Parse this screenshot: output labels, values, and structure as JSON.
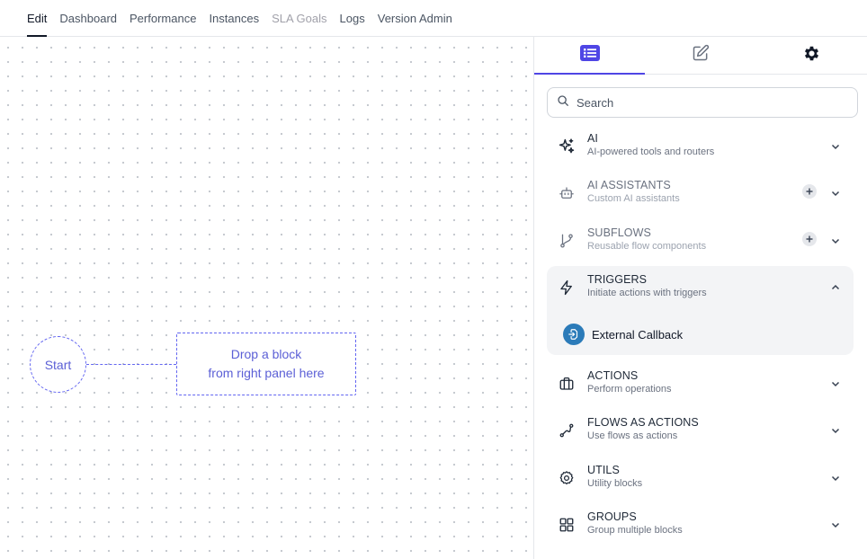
{
  "nav": {
    "tabs": [
      {
        "label": "Edit"
      },
      {
        "label": "Dashboard"
      },
      {
        "label": "Performance"
      },
      {
        "label": "Instances"
      },
      {
        "label": "SLA Goals"
      },
      {
        "label": "Logs"
      },
      {
        "label": "Version Admin"
      }
    ],
    "active": "Edit",
    "disabled": [
      "SLA Goals"
    ]
  },
  "canvas": {
    "start_label": "Start",
    "drop_line1": "Drop a block",
    "drop_line2": "from right panel here"
  },
  "panel": {
    "tabs": [
      {
        "icon": "list-icon",
        "active": true
      },
      {
        "icon": "edit-icon",
        "active": false
      },
      {
        "icon": "gear-icon",
        "active": false
      }
    ],
    "search_placeholder": "Search",
    "categories": [
      {
        "title": "AI",
        "subtitle": "AI-powered tools and routers",
        "icon": "sparkles-icon"
      },
      {
        "title": "AI ASSISTANTS",
        "subtitle": "Custom AI assistants",
        "icon": "bot-icon"
      },
      {
        "title": "SUBFLOWS",
        "subtitle": "Reusable flow components",
        "icon": "branch-icon"
      },
      {
        "title": "TRIGGERS",
        "subtitle": "Initiate actions with triggers",
        "icon": "bolt-icon",
        "expanded": true
      },
      {
        "title": "ACTIONS",
        "subtitle": "Perform operations",
        "icon": "briefcase-icon"
      },
      {
        "title": "FLOWS AS ACTIONS",
        "subtitle": "Use flows as actions",
        "icon": "route-icon"
      },
      {
        "title": "UTILS",
        "subtitle": "Utility blocks",
        "icon": "cog-icon"
      },
      {
        "title": "GROUPS",
        "subtitle": "Group multiple blocks",
        "icon": "grid-icon"
      }
    ],
    "trigger_items": [
      {
        "label": "External Callback",
        "icon": "callback-icon"
      }
    ]
  },
  "colors": {
    "accent": "#4f46e5",
    "node_dashed": "#6366f1",
    "callback_icon_bg": "#2b7bb9"
  }
}
